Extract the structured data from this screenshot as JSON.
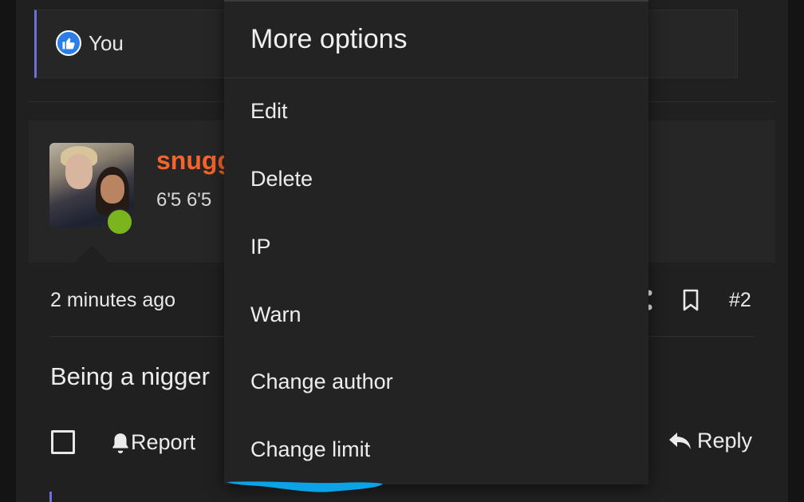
{
  "reactions": {
    "user": "You",
    "icon": "thumbs-up-icon"
  },
  "post": {
    "username": "snugg",
    "user_title": "6'5 6'5",
    "time": "2 minutes ago",
    "number": "#2",
    "body": "Being a nigger",
    "actions": {
      "report": "Report",
      "reply": "Reply"
    }
  },
  "menu": {
    "title": "More options",
    "items": [
      "Edit",
      "Delete",
      "IP",
      "Warn",
      "Change author",
      "Change limit"
    ]
  },
  "colors": {
    "accent": "#6f6fd8",
    "username": "#f5642a",
    "online": "#7ab51d",
    "annotation": "#0aa3e8"
  }
}
